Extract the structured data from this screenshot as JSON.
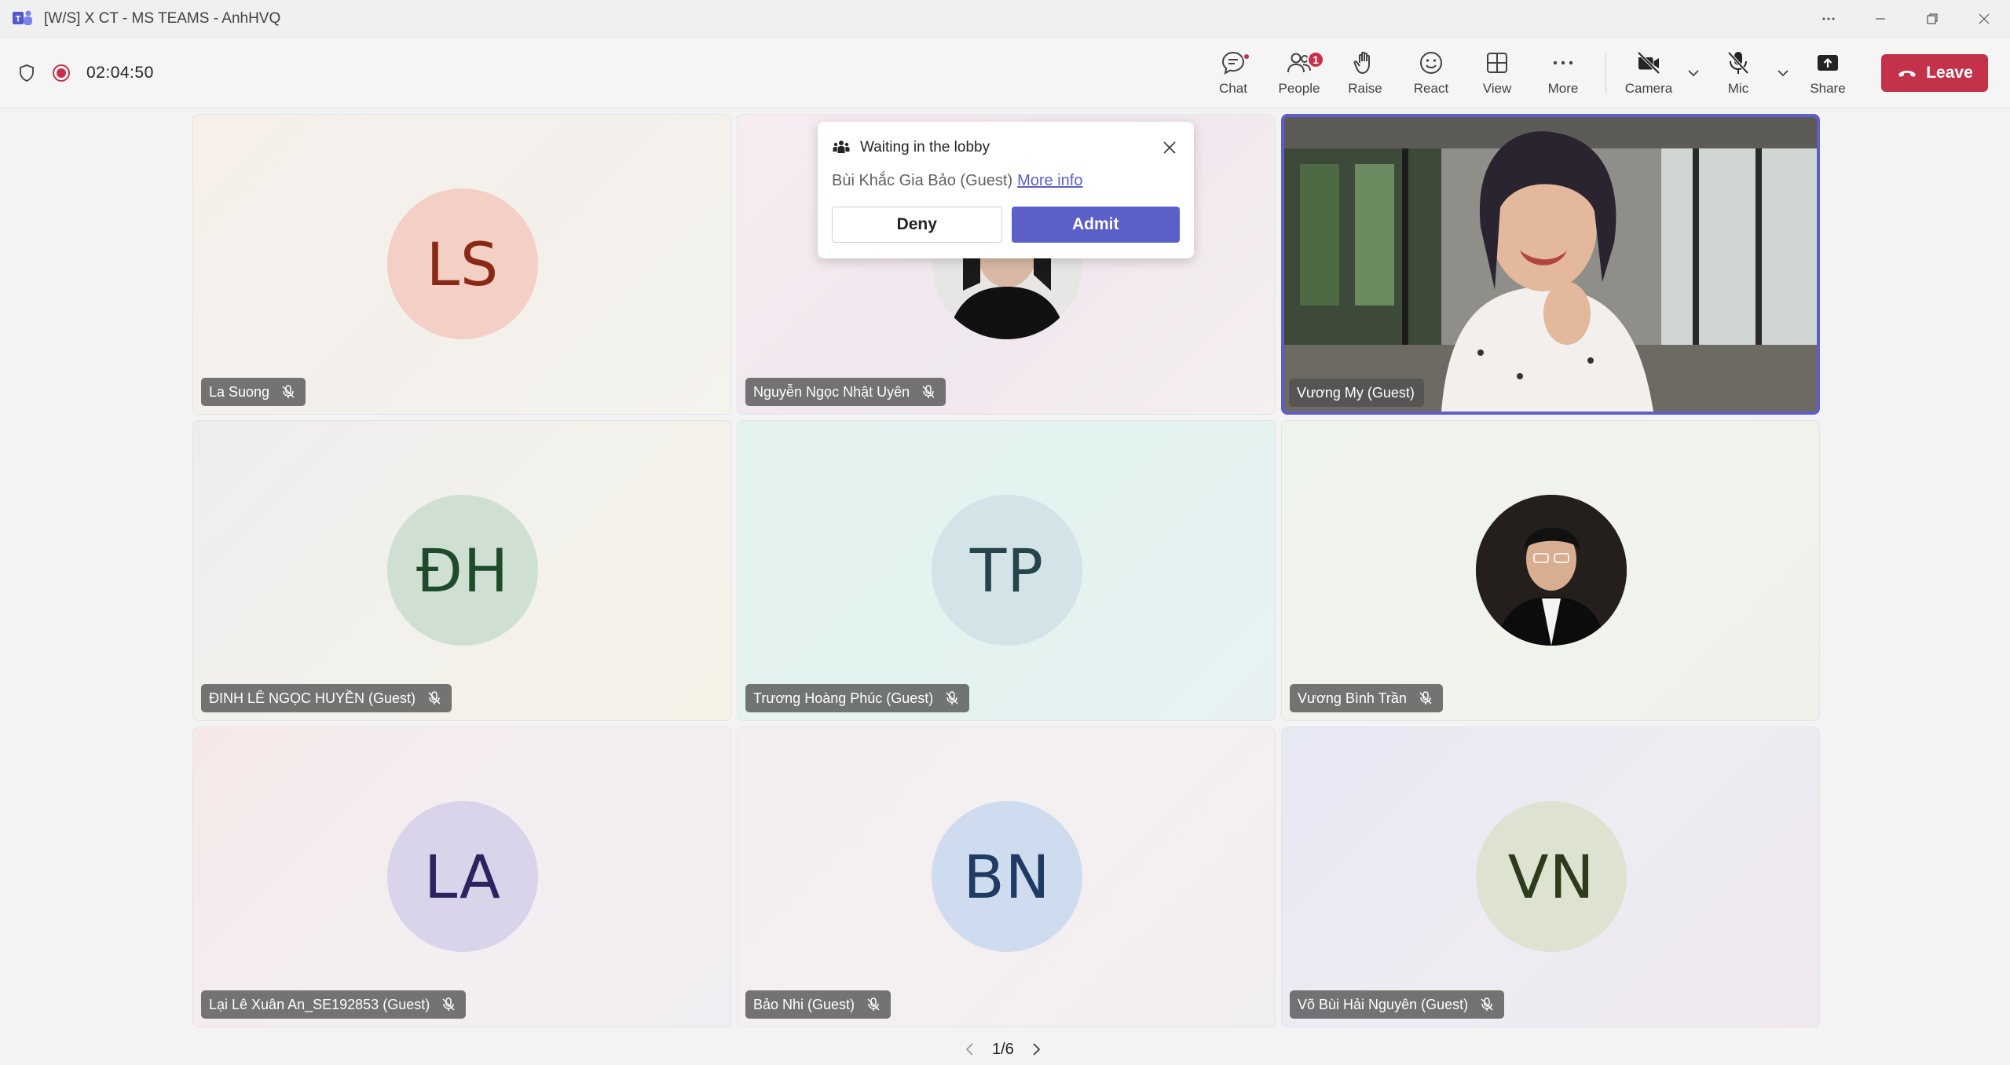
{
  "window": {
    "title": "[W/S] X CT - MS TEAMS - AnhHVQ"
  },
  "toolbar": {
    "timer": "02:04:50",
    "chat_label": "Chat",
    "people_label": "People",
    "people_badge": "1",
    "raise_label": "Raise",
    "react_label": "React",
    "view_label": "View",
    "more_label": "More",
    "camera_label": "Camera",
    "mic_label": "Mic",
    "share_label": "Share",
    "leave_label": "Leave"
  },
  "lobby": {
    "title": "Waiting in the lobby",
    "person": "Bùi Khắc Gia Bảo (Guest)",
    "more_info": "More info",
    "deny_label": "Deny",
    "admit_label": "Admit"
  },
  "participants": [
    {
      "name": "La Suong",
      "initials": "LS",
      "avatar_bg": "#f3cfc6",
      "initials_color": "#8a2a16",
      "muted": true
    },
    {
      "name": "Nguyễn Ngọc Nhật Uyên",
      "initials": "",
      "avatar_bg": "#222222",
      "muted": true
    },
    {
      "name": "Vương My (Guest)",
      "initials": "",
      "video": true,
      "muted": false
    },
    {
      "name": "ĐINH LÊ NGỌC HUYỀN (Guest)",
      "initials": "ĐH",
      "avatar_bg": "#cfe0d3",
      "initials_color": "#1f4a2c",
      "muted": true
    },
    {
      "name": "Trương Hoàng Phúc (Guest)",
      "initials": "TP",
      "avatar_bg": "#d3e3e8",
      "initials_color": "#25454d",
      "muted": true
    },
    {
      "name": "Vương Bình Trần",
      "initials": "",
      "avatar_bg": "#1a1a1a",
      "muted": true
    },
    {
      "name": "Lại Lê Xuân An_SE192853 (Guest)",
      "initials": "LA",
      "avatar_bg": "#d9d4ea",
      "initials_color": "#2b2461",
      "muted": true
    },
    {
      "name": "Bảo Nhi (Guest)",
      "initials": "BN",
      "avatar_bg": "#cfdcef",
      "initials_color": "#1f3a63",
      "muted": true
    },
    {
      "name": "Võ Bùi Hải Nguyên (Guest)",
      "initials": "VN",
      "avatar_bg": "#dde3d0",
      "initials_color": "#2e3a1c",
      "muted": true
    }
  ],
  "pager": {
    "label": "1/6"
  },
  "colors": {
    "accent": "#5b5fc7",
    "leave": "#c4314b",
    "active_speaker_border": "#5b5fc7"
  }
}
